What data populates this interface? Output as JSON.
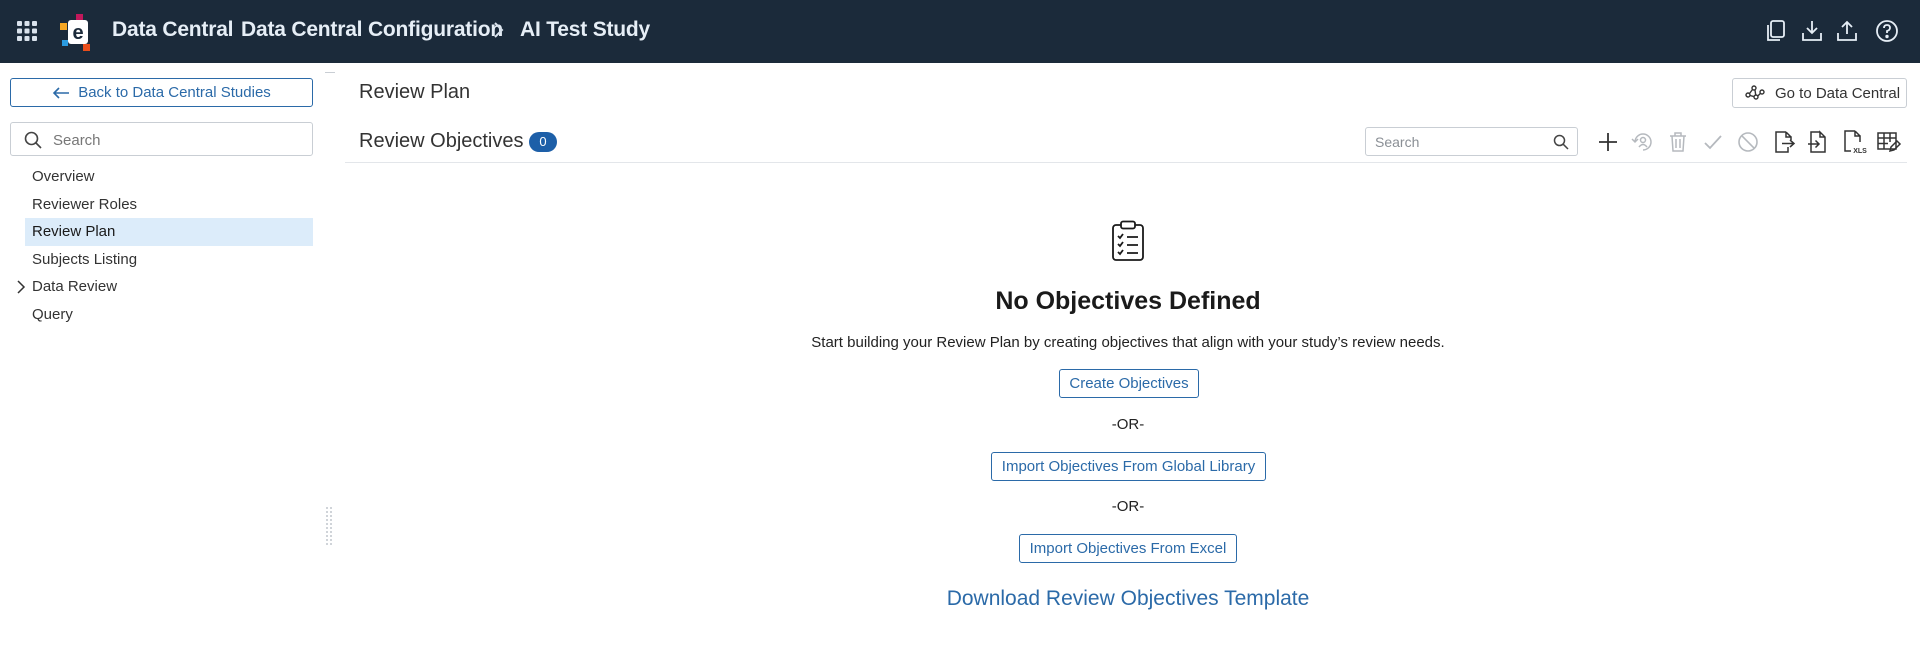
{
  "header": {
    "app_name": "Data Central",
    "breadcrumb_parent": "Data Central Configuration",
    "breadcrumb_current": "AI Test Study",
    "icons": [
      "apps-grid-icon",
      "copy-icon",
      "download-icon",
      "upload-icon",
      "help-icon"
    ]
  },
  "sidebar": {
    "back_label": "Back to Data Central Studies",
    "search_placeholder": "Search",
    "items": [
      {
        "label": "Overview"
      },
      {
        "label": "Reviewer Roles"
      },
      {
        "label": "Review Plan",
        "active": true
      },
      {
        "label": "Subjects Listing"
      },
      {
        "label": "Data Review",
        "expandable": true
      },
      {
        "label": "Query"
      }
    ]
  },
  "main": {
    "page_title": "Review Plan",
    "goto_label": "Go to Data Central",
    "section_title": "Review Objectives",
    "objective_count": "0",
    "grid_search_placeholder": "Search",
    "toolbar_icons": [
      "add-icon",
      "reassign-icon",
      "delete-icon",
      "approve-check-icon",
      "block-icon",
      "export-icon",
      "import-icon",
      "xls-icon",
      "table-edit-icon"
    ]
  },
  "empty_state": {
    "title": "No Objectives Defined",
    "description": "Start building your Review Plan by creating objectives that align with your study’s review needs.",
    "create_label": "Create Objectives",
    "or_label": "-OR-",
    "import_library_label": "Import Objectives From Global Library",
    "import_excel_label": "Import Objectives From Excel",
    "download_label": "Download Review Objectives Template"
  },
  "colors": {
    "topbar_bg": "#1b2a3a",
    "accent_blue": "#2b6aa8",
    "badge_blue": "#1d5fa8",
    "active_nav_bg": "#dcecfa"
  }
}
